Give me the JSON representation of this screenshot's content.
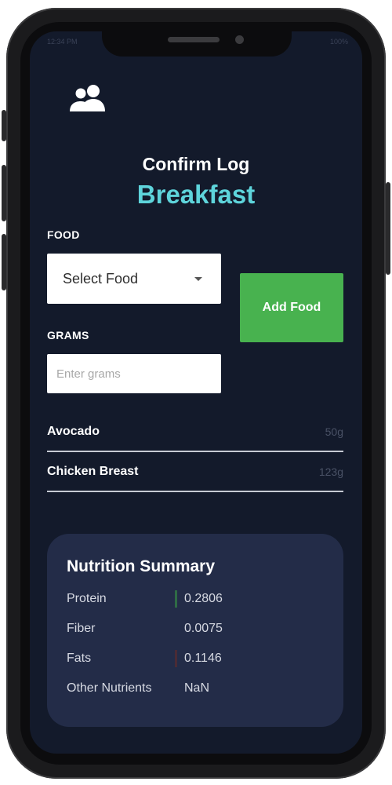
{
  "status_bar": {
    "left": "12:34 PM",
    "right": "100%"
  },
  "header": {
    "icon": "users-icon",
    "title": "Confirm Log",
    "meal": "Breakfast"
  },
  "form": {
    "food_label": "FOOD",
    "food_select_value": "Select Food",
    "add_button_label": "Add Food",
    "grams_label": "GRAMS",
    "grams_placeholder": "Enter grams"
  },
  "foods": [
    {
      "name": "Avocado",
      "grams": "50g"
    },
    {
      "name": "Chicken Breast",
      "grams": "123g"
    }
  ],
  "summary": {
    "title": "Nutrition Summary",
    "rows": [
      {
        "name": "Protein",
        "value": "0.2806",
        "bar_color": "#2f6b45"
      },
      {
        "name": "Fiber",
        "value": "0.0075",
        "bar_color": "#232c48"
      },
      {
        "name": "Fats",
        "value": "0.1146",
        "bar_color": "#4a2b35"
      },
      {
        "name": "Other Nutrients",
        "value": "NaN",
        "bar_color": "#232c48"
      }
    ]
  },
  "colors": {
    "background": "#131a2b",
    "accent": "#5ed4db",
    "button": "#48b24f",
    "card": "#232c48"
  }
}
